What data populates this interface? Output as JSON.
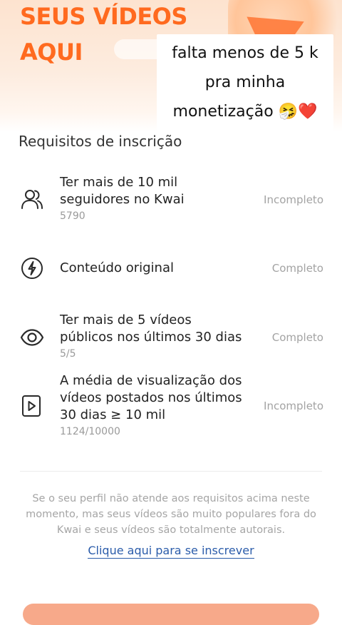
{
  "hero": {
    "title_line1": "SEUS VÍDEOS",
    "title_line2": "AQUI"
  },
  "caption": {
    "line1": "falta menos de 5 k",
    "line2": "pra minha",
    "line3": "monetização 🤧❤️"
  },
  "requirements": {
    "title": "Requisitos de inscrição",
    "items": [
      {
        "icon": "users-icon",
        "label_line1": "Ter mais de 10 mil",
        "label_line2": "seguidores no Kwai",
        "progress": "5790",
        "status": "Incompleto"
      },
      {
        "icon": "lightbulb-icon",
        "label_line1": "Conteúdo original",
        "status": "Completo"
      },
      {
        "icon": "eye-icon",
        "label_line1": "Ter mais de 5 vídeos",
        "label_line2": "públicos nos últimos 30 dias",
        "progress": "5/5",
        "status": "Completo"
      },
      {
        "icon": "play-box-icon",
        "label_line1": "A média de visualização dos",
        "label_line2": "vídeos postados nos últimos",
        "label_line3": "30 dias ≥ 10 mil",
        "progress": "1124/10000",
        "status": "Incompleto"
      }
    ]
  },
  "footer": {
    "note_line1": "Se o seu perfil não atende aos requisitos acima neste",
    "note_line2": "momento, mas seus vídeos são muito populares fora do",
    "note_line3": "Kwai e seus vídeos são totalmente autorais.",
    "link_label": "Clique aqui para se inscrever"
  },
  "colors": {
    "accent": "#ff6a1f",
    "link": "#2b5caa",
    "status": "#a3a3a3",
    "button": "#f7a98a"
  }
}
